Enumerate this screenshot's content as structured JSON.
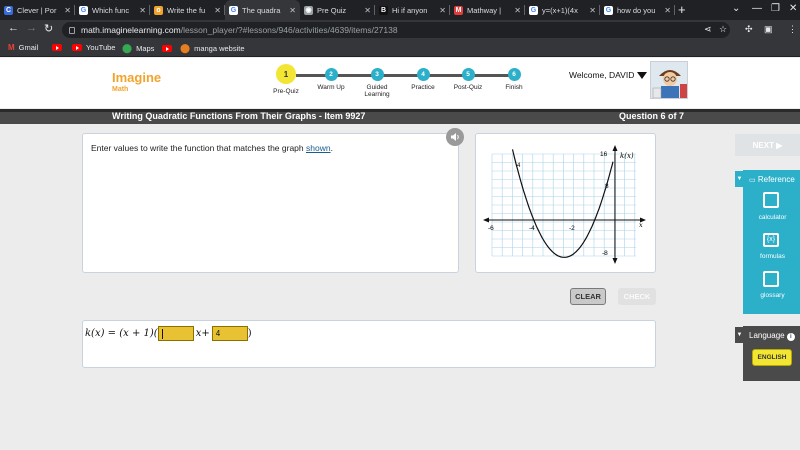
{
  "browser": {
    "tabs": [
      {
        "title": "Clever | Por",
        "fav": "#3b6bd6",
        "letter": "C"
      },
      {
        "title": "Which func",
        "fav": "#ffffff",
        "letter": "G"
      },
      {
        "title": "Write the fu",
        "fav": "#f1a42c",
        "letter": "o"
      },
      {
        "title": "The quadra",
        "fav": "#ffffff",
        "letter": "G",
        "active": true
      },
      {
        "title": "Pre Quiz",
        "fav": "#9aa0a6",
        "letter": "◉"
      },
      {
        "title": "Hi if anyon",
        "fav": "#111111",
        "letter": "B"
      },
      {
        "title": "Mathway |",
        "fav": "#e23b3b",
        "letter": "M"
      },
      {
        "title": "y=(x+1)(4x",
        "fav": "#ffffff",
        "letter": "G"
      },
      {
        "title": "how do you",
        "fav": "#ffffff",
        "letter": "G"
      }
    ],
    "url_host": "math.imaginelearning.com",
    "url_path": "/lesson_player/?#lessons/946/activities/4639/items/27138",
    "bookmarks": [
      "Gmail",
      "YouTube",
      "Maps",
      "manga website"
    ]
  },
  "header": {
    "logo_main": "Imagine",
    "logo_sub": "Math",
    "steps": [
      "Pre-Quiz",
      "Warm Up",
      "Guided Learning",
      "Practice",
      "Post-Quiz",
      "Finish"
    ],
    "step_numbers": [
      "1",
      "2",
      "3",
      "4",
      "5",
      "6"
    ],
    "current_step": 1,
    "welcome": "Welcome, DAVID"
  },
  "titlebar": {
    "title": "Writing Quadratic Functions From Their Graphs - Item 9927",
    "question": "Question 6 of 7"
  },
  "prompt": {
    "text": "Enter values to write the function that matches the graph",
    "link": "shown",
    "end": "."
  },
  "graph": {
    "function_label": "k(x)",
    "x_axis_label": "x",
    "x_ticks": [
      "-6",
      "-4",
      "-2",
      "x"
    ],
    "y_ticks": [
      "16",
      "8",
      "-8"
    ],
    "y_side_tick": "4"
  },
  "buttons": {
    "clear": "CLEAR",
    "check": "CHECK",
    "next": "NEXT ▶"
  },
  "equation": {
    "lhs": "k(x) = (x + 1)(",
    "mid": "x+",
    "box1_value": "",
    "box2_value": "4",
    "rhs": ")"
  },
  "reference": {
    "heading": "Reference",
    "items": [
      "calculator",
      "formulas",
      "glossary"
    ]
  },
  "language": {
    "heading": "Language",
    "button": "ENGLISH"
  },
  "colors": {
    "accent_teal": "#2cb0c9",
    "highlight_yellow": "#f3e533",
    "input_yellow": "#e8c233",
    "logo_orange": "#f1a42c"
  }
}
